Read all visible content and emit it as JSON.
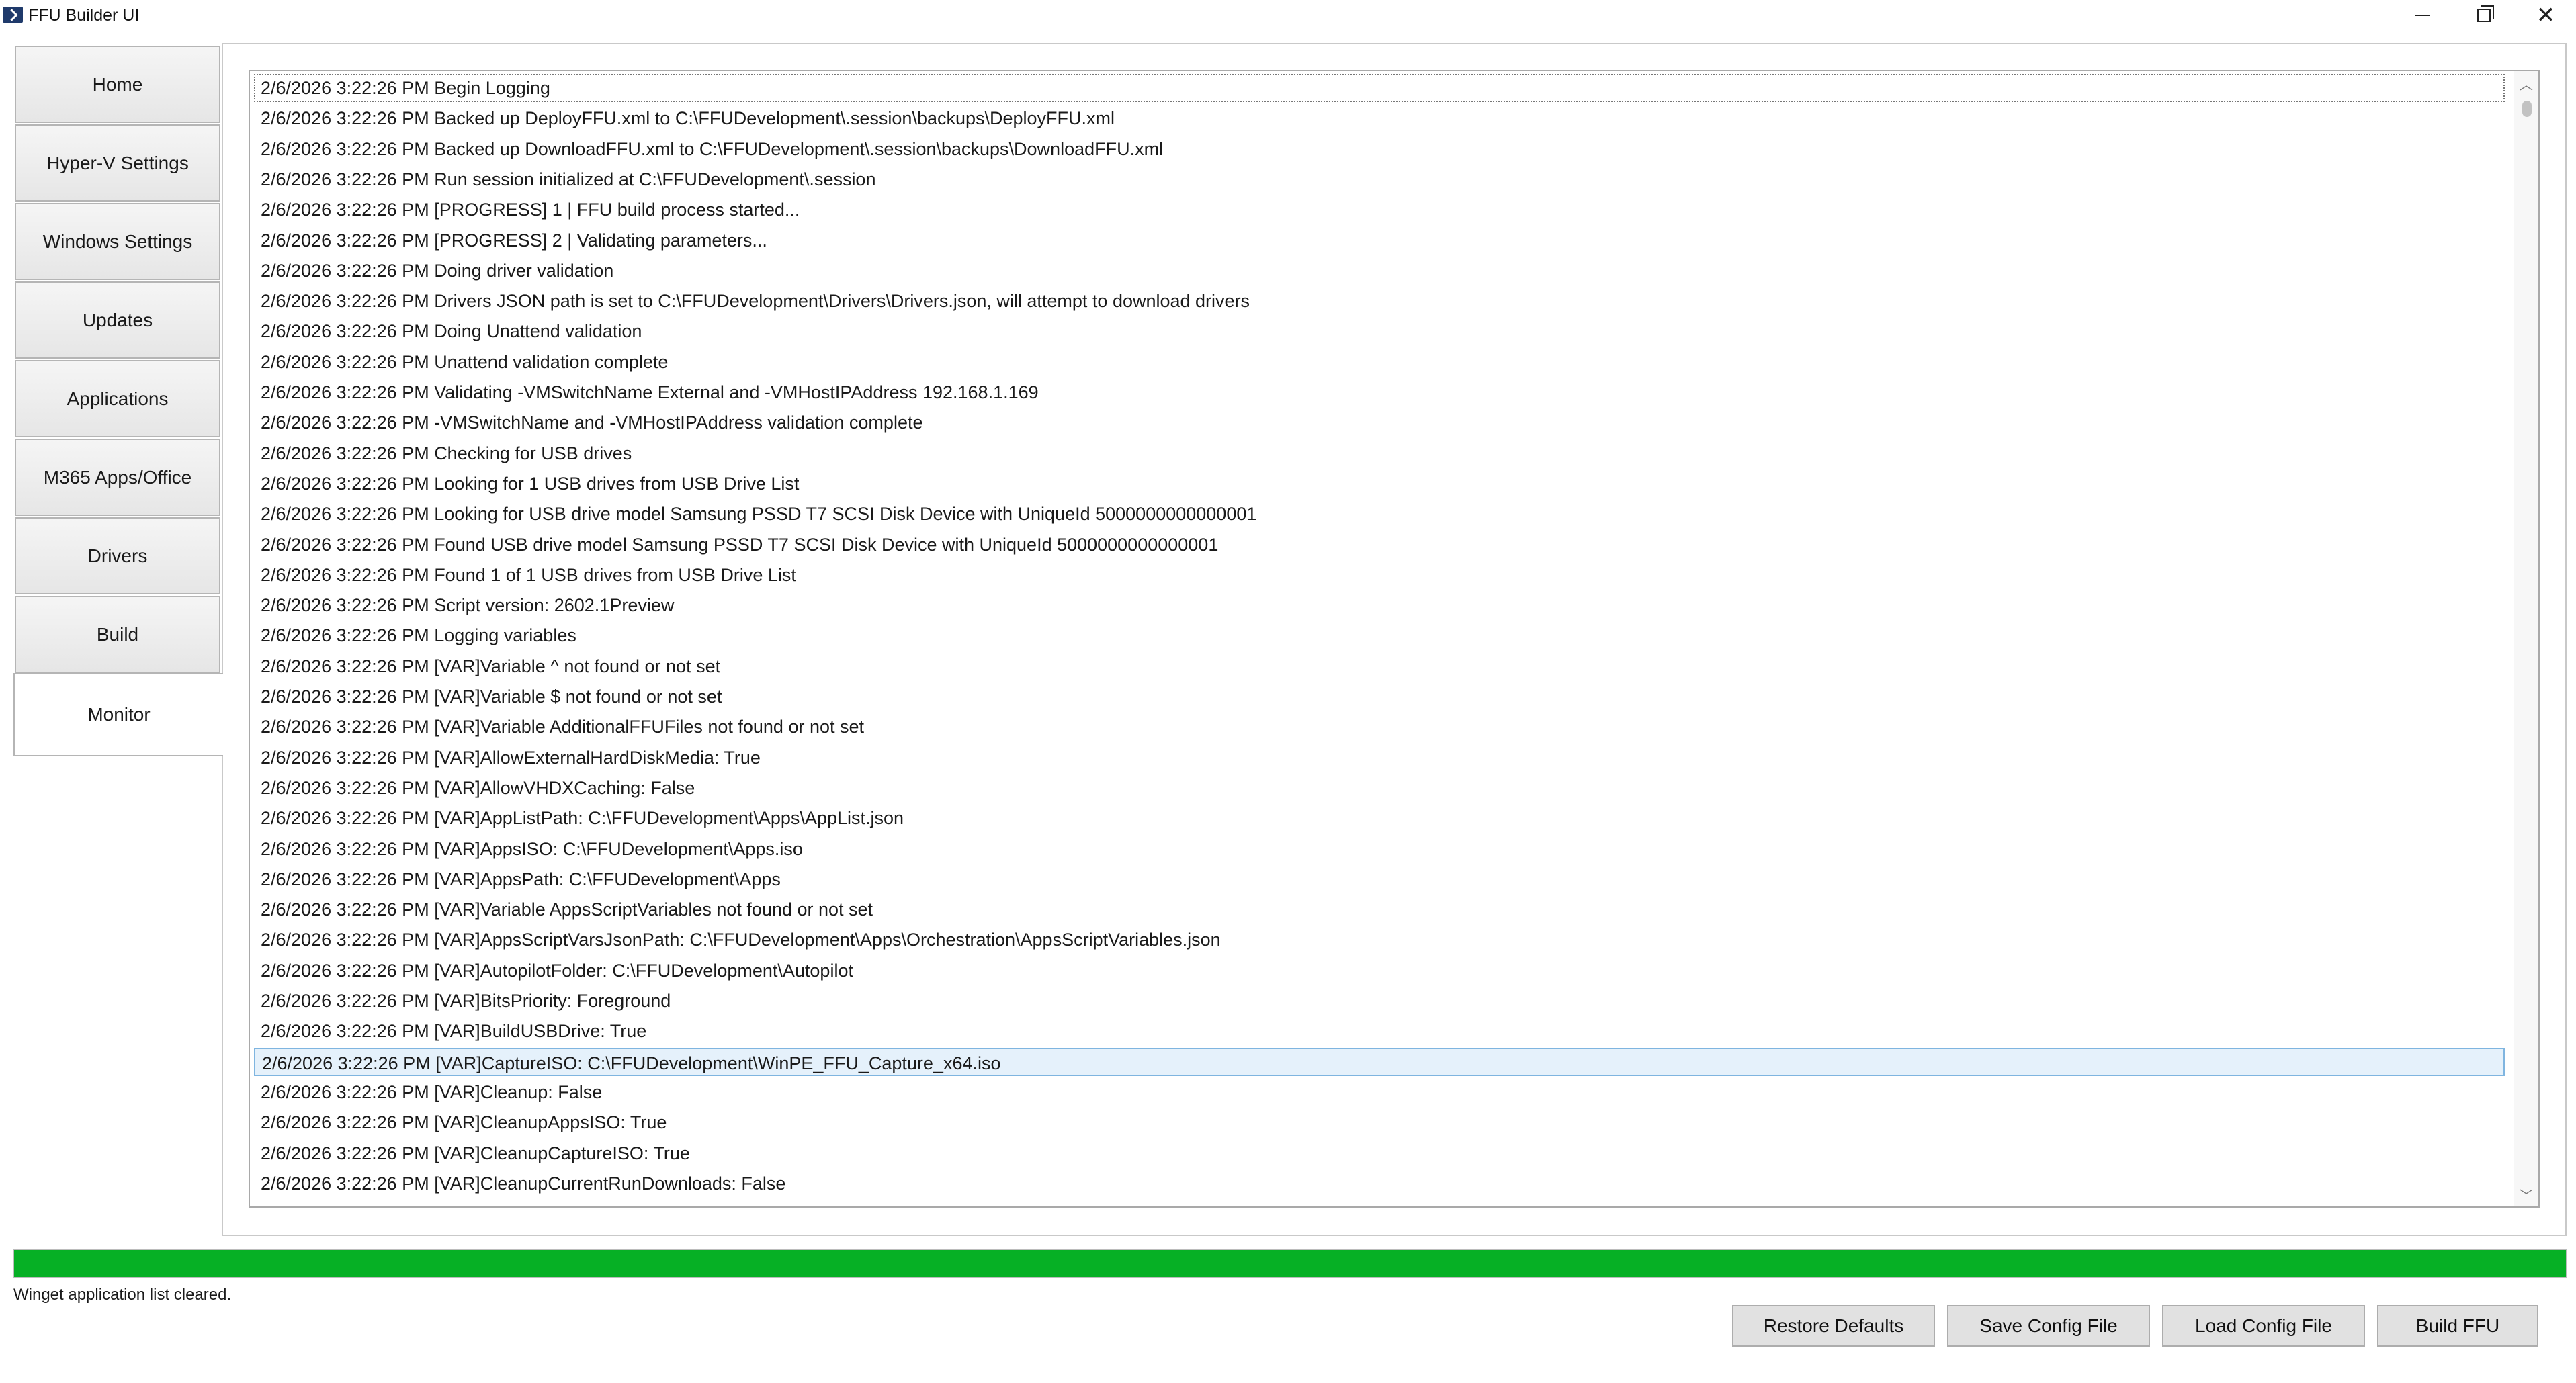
{
  "window": {
    "title": "FFU Builder UI"
  },
  "tabs": [
    {
      "label": "Home"
    },
    {
      "label": "Hyper-V Settings"
    },
    {
      "label": "Windows Settings"
    },
    {
      "label": "Updates"
    },
    {
      "label": "Applications"
    },
    {
      "label": "M365 Apps/Office"
    },
    {
      "label": "Drivers"
    },
    {
      "label": "Build"
    },
    {
      "label": "Monitor",
      "active": true
    }
  ],
  "log": [
    "2/6/2026 3:22:26 PM Begin Logging",
    "2/6/2026 3:22:26 PM Backed up DeployFFU.xml to C:\\FFUDevelopment\\.session\\backups\\DeployFFU.xml",
    "2/6/2026 3:22:26 PM Backed up DownloadFFU.xml to C:\\FFUDevelopment\\.session\\backups\\DownloadFFU.xml",
    "2/6/2026 3:22:26 PM Run session initialized at C:\\FFUDevelopment\\.session",
    "2/6/2026 3:22:26 PM [PROGRESS] 1 | FFU build process started...",
    "2/6/2026 3:22:26 PM [PROGRESS] 2 | Validating parameters...",
    "2/6/2026 3:22:26 PM Doing driver validation",
    "2/6/2026 3:22:26 PM Drivers JSON path is set to C:\\FFUDevelopment\\Drivers\\Drivers.json, will attempt to download drivers",
    "2/6/2026 3:22:26 PM Doing Unattend validation",
    "2/6/2026 3:22:26 PM Unattend validation complete",
    "2/6/2026 3:22:26 PM Validating -VMSwitchName External and -VMHostIPAddress 192.168.1.169",
    "2/6/2026 3:22:26 PM -VMSwitchName and -VMHostIPAddress validation complete",
    "2/6/2026 3:22:26 PM Checking for USB drives",
    "2/6/2026 3:22:26 PM Looking for 1 USB drives from USB Drive List",
    "2/6/2026 3:22:26 PM Looking for USB drive model Samsung PSSD T7 SCSI Disk Device with UniqueId 5000000000000001",
    "2/6/2026 3:22:26 PM Found USB drive model Samsung PSSD T7 SCSI Disk Device with UniqueId 5000000000000001",
    "2/6/2026 3:22:26 PM Found 1 of 1 USB drives from USB Drive List",
    "2/6/2026 3:22:26 PM Script version: 2602.1Preview",
    "2/6/2026 3:22:26 PM Logging variables",
    "2/6/2026 3:22:26 PM [VAR]Variable ^ not found or not set",
    "2/6/2026 3:22:26 PM [VAR]Variable $ not found or not set",
    "2/6/2026 3:22:26 PM [VAR]Variable AdditionalFFUFiles not found or not set",
    "2/6/2026 3:22:26 PM [VAR]AllowExternalHardDiskMedia: True",
    "2/6/2026 3:22:26 PM [VAR]AllowVHDXCaching: False",
    "2/6/2026 3:22:26 PM [VAR]AppListPath: C:\\FFUDevelopment\\Apps\\AppList.json",
    "2/6/2026 3:22:26 PM [VAR]AppsISO: C:\\FFUDevelopment\\Apps.iso",
    "2/6/2026 3:22:26 PM [VAR]AppsPath: C:\\FFUDevelopment\\Apps",
    "2/6/2026 3:22:26 PM [VAR]Variable AppsScriptVariables not found or not set",
    "2/6/2026 3:22:26 PM [VAR]AppsScriptVarsJsonPath: C:\\FFUDevelopment\\Apps\\Orchestration\\AppsScriptVariables.json",
    "2/6/2026 3:22:26 PM [VAR]AutopilotFolder: C:\\FFUDevelopment\\Autopilot",
    "2/6/2026 3:22:26 PM [VAR]BitsPriority: Foreground",
    "2/6/2026 3:22:26 PM [VAR]BuildUSBDrive: True",
    "2/6/2026 3:22:26 PM [VAR]CaptureISO: C:\\FFUDevelopment\\WinPE_FFU_Capture_x64.iso",
    "2/6/2026 3:22:26 PM [VAR]Cleanup: False",
    "2/6/2026 3:22:26 PM [VAR]CleanupAppsISO: True",
    "2/6/2026 3:22:26 PM [VAR]CleanupCaptureISO: True",
    "2/6/2026 3:22:26 PM [VAR]CleanupCurrentRunDownloads: False"
  ],
  "log_selected_index": 32,
  "progress": {
    "fraction": 1.0,
    "color": "#06b025"
  },
  "status_text": "Winget application list cleared.",
  "buttons": {
    "restore": "Restore Defaults",
    "save": "Save Config File",
    "load": "Load Config File",
    "build": "Build FFU"
  },
  "icons": {
    "app": "powershell-icon",
    "minimize": "minimize-icon",
    "restore": "restore-window-icon",
    "close": "close-icon"
  }
}
